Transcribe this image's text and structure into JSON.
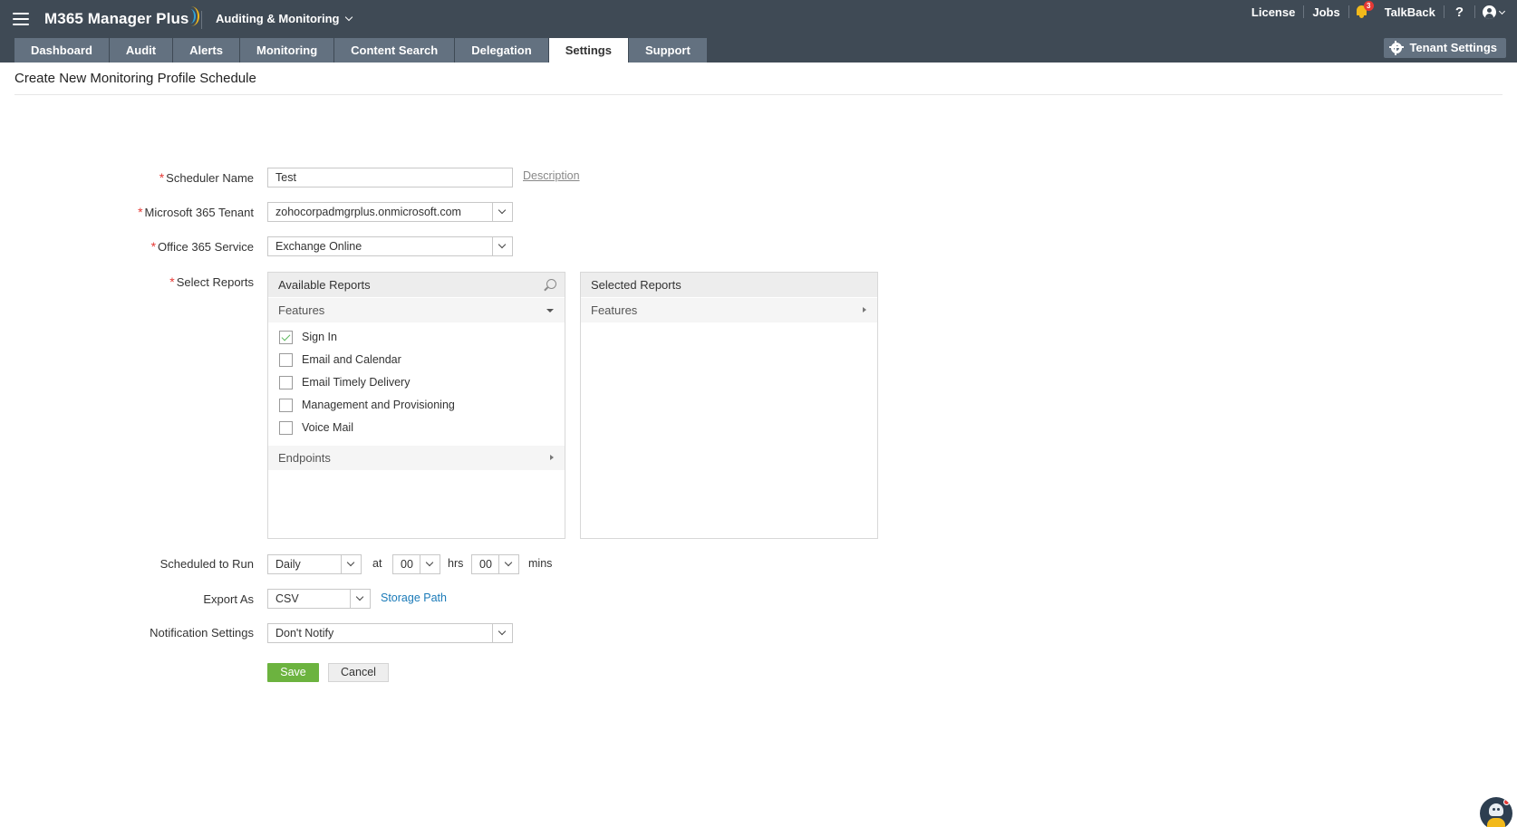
{
  "app": {
    "brand": "M365 Manager Plus",
    "module": "Auditing & Monitoring"
  },
  "top_links": {
    "license": "License",
    "jobs": "Jobs",
    "notification_count": "3",
    "talkback": "TalkBack",
    "help": "?"
  },
  "tabs": [
    {
      "label": "Dashboard"
    },
    {
      "label": "Audit"
    },
    {
      "label": "Alerts"
    },
    {
      "label": "Monitoring"
    },
    {
      "label": "Content Search"
    },
    {
      "label": "Delegation"
    },
    {
      "label": "Settings",
      "active": true
    },
    {
      "label": "Support"
    }
  ],
  "tenant_settings": "Tenant Settings",
  "page": {
    "title": "Create New Monitoring Profile Schedule"
  },
  "form": {
    "scheduler_name": {
      "label": "Scheduler Name",
      "value": "Test",
      "description_link": "Description"
    },
    "tenant": {
      "label": "Microsoft 365 Tenant",
      "value": "zohocorpadmgrplus.onmicrosoft.com"
    },
    "service": {
      "label": "Office 365 Service",
      "value": "Exchange Online"
    },
    "select_reports": {
      "label": "Select Reports",
      "available_header": "Available Reports",
      "selected_header": "Selected Reports",
      "available_groups": [
        {
          "label": "Features",
          "expanded": true
        },
        {
          "label": "Endpoints",
          "expanded": false
        }
      ],
      "feature_items": [
        {
          "label": "Sign In",
          "checked": true
        },
        {
          "label": "Email and Calendar",
          "checked": false
        },
        {
          "label": "Email Timely Delivery",
          "checked": false
        },
        {
          "label": "Management and Provisioning",
          "checked": false
        },
        {
          "label": "Voice Mail",
          "checked": false
        }
      ],
      "selected_groups": [
        {
          "label": "Features"
        }
      ]
    },
    "schedule": {
      "label": "Scheduled to Run",
      "frequency": "Daily",
      "at_text": "at",
      "hours": "00",
      "hrs_text": "hrs",
      "minutes": "00",
      "mins_text": "mins"
    },
    "export": {
      "label": "Export As",
      "value": "CSV",
      "storage_link": "Storage Path"
    },
    "notification": {
      "label": "Notification Settings",
      "value": "Don't Notify"
    },
    "save_label": "Save",
    "cancel_label": "Cancel"
  },
  "colors": {
    "header_bg": "#3f4a55",
    "tab_bg": "#637180",
    "accent_yellow": "#f2b91b",
    "save_green": "#6cb33f",
    "link_blue": "#1a7ab8",
    "required_red": "#e53935"
  }
}
